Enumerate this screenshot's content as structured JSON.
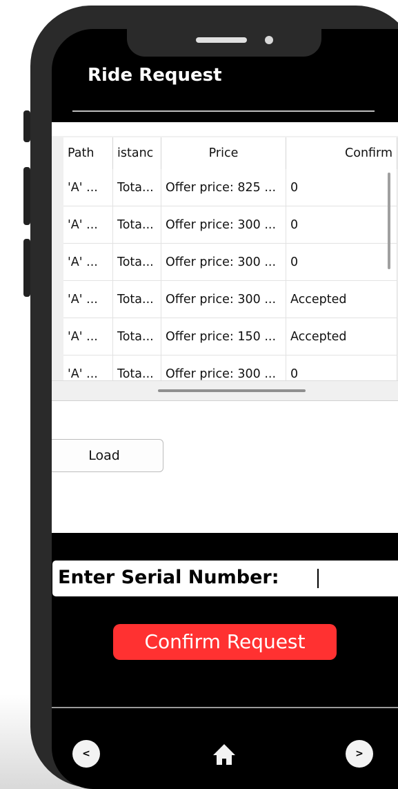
{
  "header": {
    "title": "Ride Request"
  },
  "table": {
    "columns": [
      "Path",
      "istanc",
      "Price",
      "Confirm"
    ],
    "rows": [
      [
        "'A' ...",
        "Tota...",
        "Offer price: 825 ...",
        "0"
      ],
      [
        "'A' ...",
        "Tota...",
        "Offer price: 300 ...",
        "0"
      ],
      [
        "'A' ...",
        "Tota...",
        "Offer price: 300 ...",
        "0"
      ],
      [
        "'A' ...",
        "Tota...",
        "Offer price: 300 ...",
        "Accepted"
      ],
      [
        "'A' ...",
        "Tota...",
        "Offer price: 150 ...",
        "Accepted"
      ],
      [
        "'A' ...",
        "Tota...",
        "Offer price: 300 ...",
        "0"
      ]
    ]
  },
  "load_button": {
    "label": "Load"
  },
  "serial": {
    "label": "Enter Serial Number:"
  },
  "confirm_button": {
    "label": "Confirm Request"
  },
  "nav": {
    "back_label": "<",
    "forward_label": ">"
  },
  "colors": {
    "accent": "#ff3131",
    "background": "#000000"
  }
}
